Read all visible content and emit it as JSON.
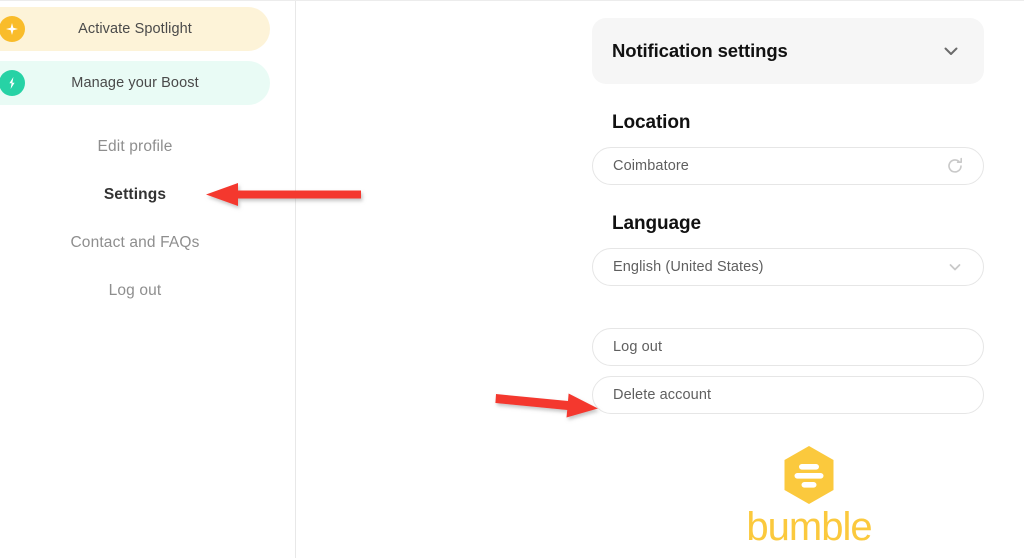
{
  "app": {
    "brand_name": "bumble",
    "brand_color": "#fbc93d"
  },
  "sidebar": {
    "promos": [
      {
        "label": "Activate Spotlight",
        "icon": "sparkle-icon",
        "pill_color": "#fdf3d8",
        "icon_color": "#f9bc2a"
      },
      {
        "label": "Manage your Boost",
        "icon": "lightning-bolt-icon",
        "pill_color": "#e9fbf5",
        "icon_color": "#27d2a5"
      }
    ],
    "nav_items": [
      {
        "label": "Edit profile",
        "active": false
      },
      {
        "label": "Settings",
        "active": true
      },
      {
        "label": "Contact and FAQs",
        "active": false
      },
      {
        "label": "Log out",
        "active": false
      }
    ]
  },
  "main": {
    "notification_settings": {
      "title": "Notification settings",
      "icon": "chevron-down-icon"
    },
    "location": {
      "heading": "Location",
      "value": "Coimbatore",
      "icon": "refresh-icon"
    },
    "language": {
      "heading": "Language",
      "value": "English (United States)",
      "icon": "chevron-down-icon"
    },
    "actions": [
      {
        "label": "Log out"
      },
      {
        "label": "Delete account"
      }
    ]
  },
  "annotations": {
    "arrow_color": "#f4382f",
    "arrows": [
      {
        "name": "arrow-pointing-at-settings",
        "direction": "left"
      },
      {
        "name": "arrow-pointing-at-delete-account",
        "direction": "right"
      }
    ]
  }
}
